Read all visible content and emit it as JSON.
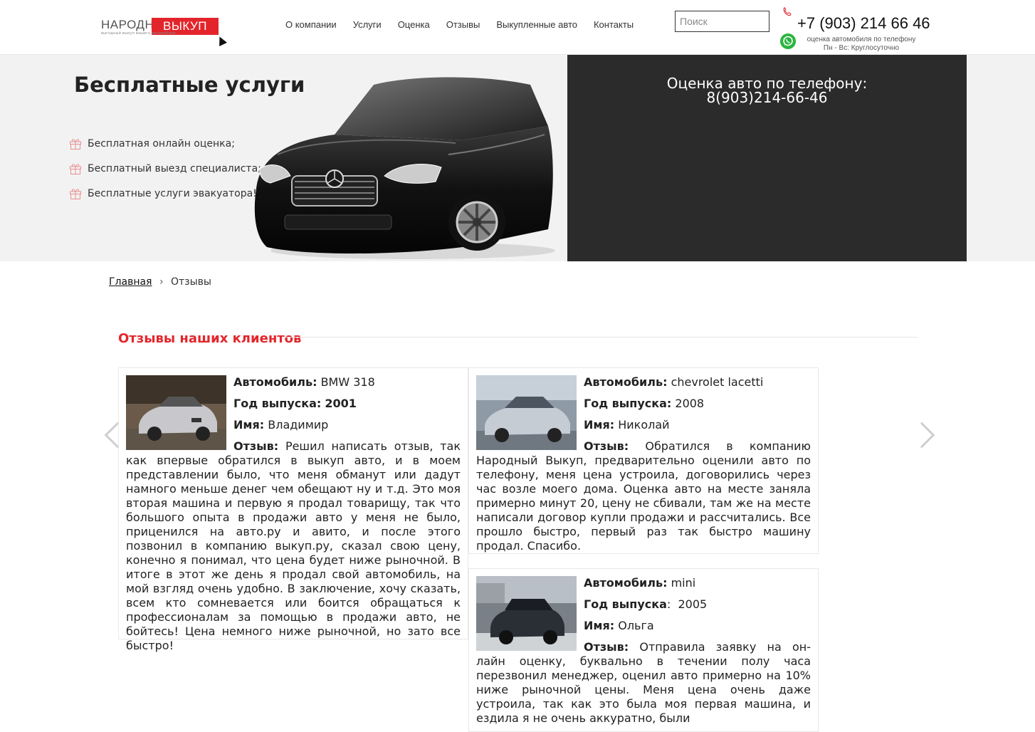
{
  "header": {
    "logo_left": "НАРОДНЫЙ",
    "logo_right": "ВЫКУП",
    "logo_sub": "выгодный выкуп вашего автомобиля",
    "nav": [
      {
        "label": "О компании"
      },
      {
        "label": "Услуги"
      },
      {
        "label": "Оценка"
      },
      {
        "label": "Отзывы"
      },
      {
        "label": "Выкупленные авто"
      },
      {
        "label": "Контакты"
      }
    ],
    "search_placeholder": "Поиск",
    "phone": "+7 (903) 214 66 46",
    "phone_note_1": "оценка автомобиля по телефону",
    "phone_note_2": "Пн - Вс: Круглосуточно"
  },
  "banner": {
    "title": "Бесплатные услуги",
    "benefits": [
      {
        "text": "Бесплатная онлайн оценка;"
      },
      {
        "text": "Бесплатный выезд специалиста;"
      },
      {
        "text": "Бесплатные услуги эвакуатора!"
      }
    ],
    "panel_line1": "Оценка авто по телефону:",
    "panel_line2": "8(903)214-66-46"
  },
  "breadcrumb": {
    "home": "Главная",
    "separator": "›",
    "current": "Отзывы"
  },
  "reviews": {
    "title": "Отзывы наших клиентов",
    "items": [
      {
        "car_label": "Автомобиль:",
        "car": "BMW 318",
        "year_label": "Год выпуска:",
        "year": "2001",
        "name_label": "Имя:",
        "name": "Владимир",
        "review_label": "Отзыв:",
        "review": "Решил написать отзыв, так как впервые обратился в выкуп авто, и в моем представлении было, что меня обманут или дадут намного меньше денег чем обещают ну и т.д. Это моя вторая машина и первую я продал товарищу, так что большого опыта в продажи авто у меня не было, прицени­лся на авто.ру и авито, и по­сле этого позвонил в компанию выкуп.ру, сказал свою цену, конечно я понимал, что цена будет ниже рыночной. В итоге в этот же день я продал свой автомобиль, на мой взгляд очень удобно. В заключение, хочу сказать, всем кто сомневается или боится обращаться к профессионалам за помощью в продажи авто, не бойтесь! Цена немного ниже рыночной, но зато все быстро!"
      },
      {
        "car_label": "Автомобиль:",
        "car": "chevrolet lacetti",
        "year_label": "Год выпуска:",
        "year": "2008",
        "name_label": "Имя:",
        "name": "Николай",
        "review_label": "Отзыв:",
        "review": "Обратился в компанию Народ­ный Выкуп, предварительно оценили авто по телефону, меня цена устроила, договорились через час возле моего дома. Оценка авто на месте заняла примерно минут 20, цену не сбивали, там же на месте написали договор купли продажи и рассчитались. Все прошло быстро, первый раз так быстро машину продал. Спасибо."
      },
      {
        "car_label": "Автомобиль:",
        "car": "mini",
        "year_label": "Год выпуска",
        "year": "2005",
        "name_label": "Имя:",
        "name": "Ольга",
        "review_label": "Отзыв:",
        "review": "Отправила заявку на он-лайн оценку, буквально в течении полу часа перезвонил мене­джер, оценил авто примерно на 10% ниже рыночной цены. Меня цена очень даже устроила, так как это была моя первая машина, и ездила я не очень аккуратно, были"
      }
    ]
  },
  "colors": {
    "accent": "#e3252b",
    "dark_panel": "#2b2b2b",
    "banner_bg": "#f2f2f2",
    "whatsapp": "#2ab540"
  }
}
